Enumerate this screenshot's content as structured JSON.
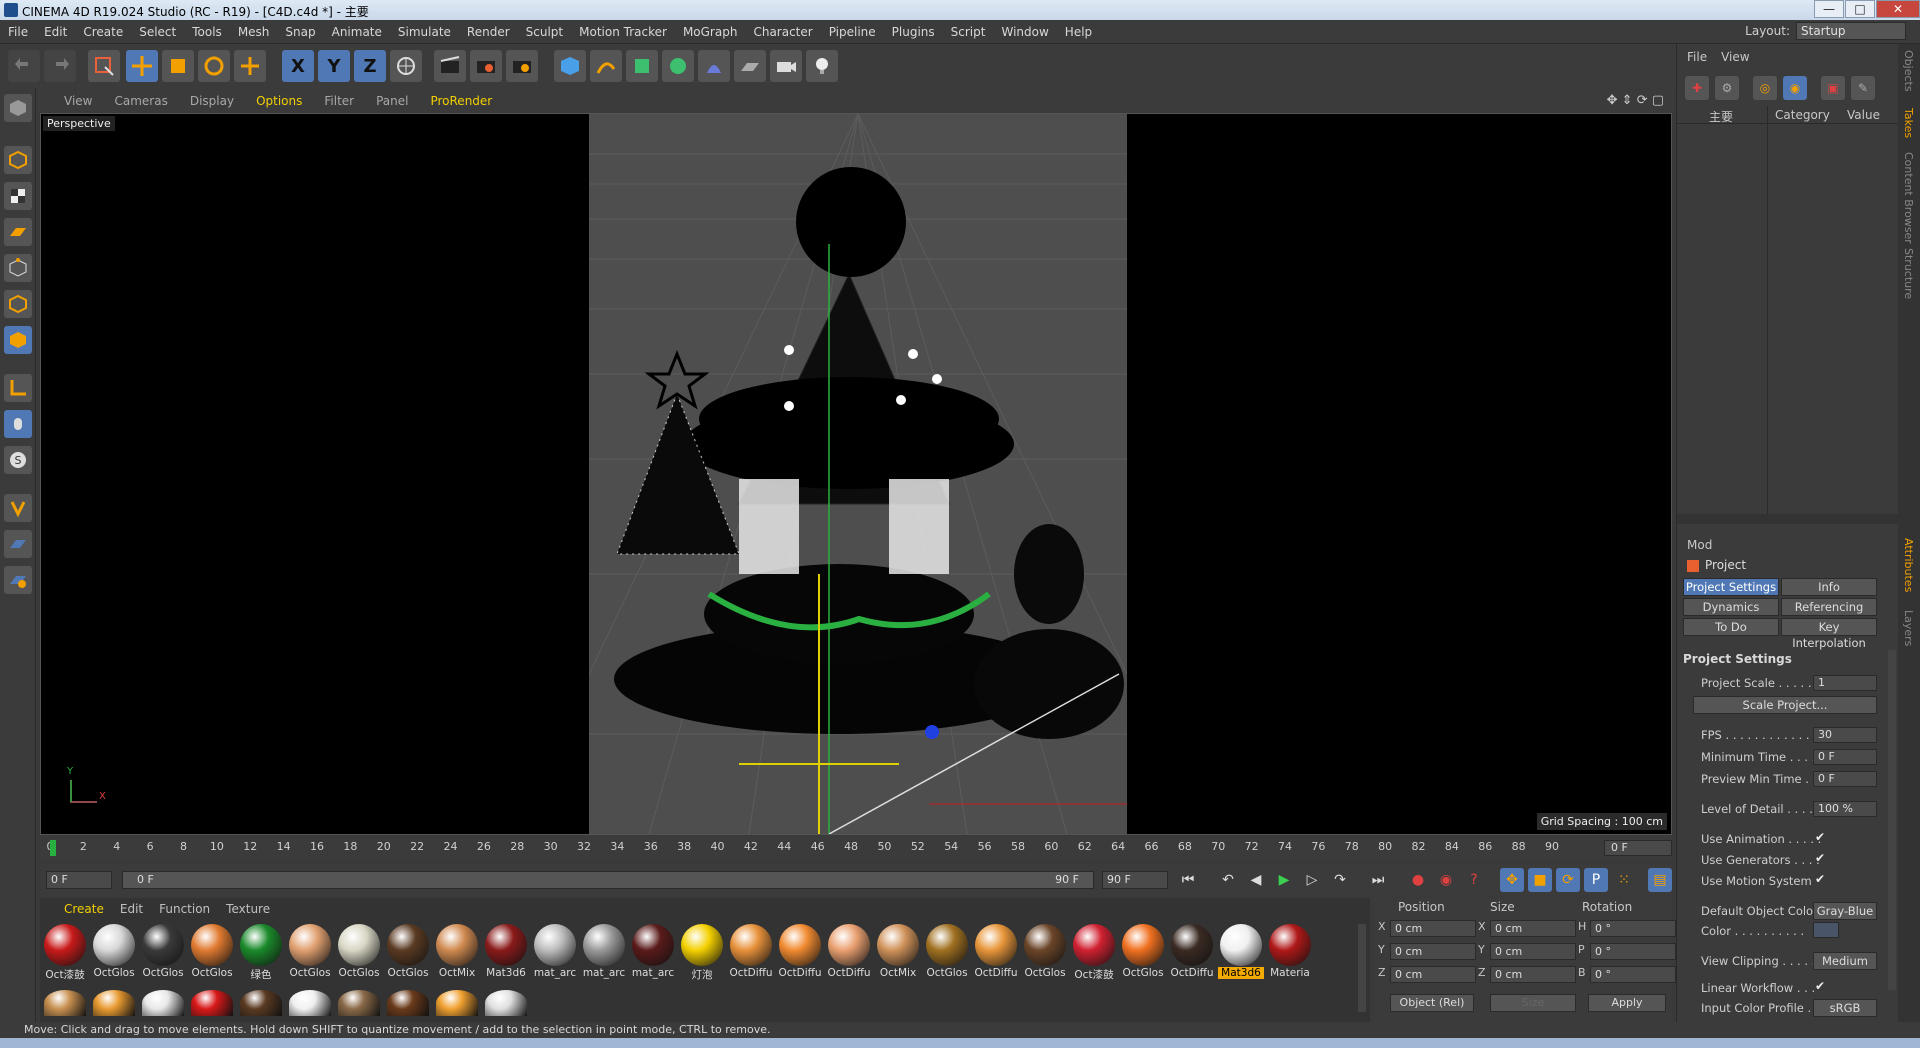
{
  "window": {
    "title": "CINEMA 4D R19.024 Studio (RC - R19) - [C4D.c4d *] - 主要",
    "controls": [
      "—",
      "□",
      "✕"
    ]
  },
  "menu": [
    "File",
    "Edit",
    "Create",
    "Select",
    "Tools",
    "Mesh",
    "Snap",
    "Animate",
    "Simulate",
    "Render",
    "Sculpt",
    "Motion Tracker",
    "MoGraph",
    "Character",
    "Pipeline",
    "Plugins",
    "Script",
    "Window",
    "Help"
  ],
  "layout": {
    "label": "Layout:",
    "value": "Startup"
  },
  "toolbar": {
    "axis_x": "X",
    "axis_y": "Y",
    "axis_z": "Z"
  },
  "viewport": {
    "menu": [
      "View",
      "Cameras",
      "Display",
      "Options",
      "Filter",
      "Panel",
      "ProRender"
    ],
    "active_menu": "Options",
    "camera_label": "Perspective",
    "grid_spacing": "Grid Spacing : 100 cm",
    "axis_y": "Y",
    "axis_x": "X"
  },
  "timeline": {
    "ticks": [
      "0",
      "2",
      "4",
      "6",
      "8",
      "10",
      "12",
      "14",
      "16",
      "18",
      "20",
      "22",
      "24",
      "26",
      "28",
      "30",
      "32",
      "34",
      "36",
      "38",
      "40",
      "42",
      "44",
      "46",
      "48",
      "50",
      "52",
      "54",
      "56",
      "58",
      "60",
      "62",
      "64",
      "66",
      "68",
      "70",
      "72",
      "74",
      "76",
      "78",
      "80",
      "82",
      "84",
      "86",
      "88",
      "90"
    ],
    "current_frame": "0 F",
    "start": "0 F",
    "slider_start": "0 F",
    "slider_end": "90 F",
    "end": "90 F"
  },
  "materials": {
    "tabs": [
      "Create",
      "Edit",
      "Function",
      "Texture"
    ],
    "active_tab": "Create",
    "items": [
      {
        "label": "Oct漆鼓",
        "color": "#c81a1a"
      },
      {
        "label": "OctGlos",
        "color": "#d8d8d8"
      },
      {
        "label": "OctGlos",
        "color": "#3a3a3a"
      },
      {
        "label": "OctGlos",
        "color": "#e07a30"
      },
      {
        "label": "绿色",
        "color": "#1a8a2a"
      },
      {
        "label": "OctGlos",
        "color": "#e0a070"
      },
      {
        "label": "OctGlos",
        "color": "#d8d6c4"
      },
      {
        "label": "OctGlos",
        "color": "#5a3a22"
      },
      {
        "label": "OctMix",
        "color": "#d08a50"
      },
      {
        "label": "Mat3d6",
        "color": "#8a1a1a"
      },
      {
        "label": "mat_arc",
        "color": "#bdbdbd"
      },
      {
        "label": "mat_arc",
        "color": "#9a9a9a"
      },
      {
        "label": "mat_arc",
        "color": "#5a1a1a"
      },
      {
        "label": "灯泡",
        "color": "#f4d000"
      },
      {
        "label": "OctDiffu",
        "color": "#e8913a"
      },
      {
        "label": "OctDiffu",
        "color": "#f08a30"
      },
      {
        "label": "OctDiffu",
        "color": "#eaa070"
      },
      {
        "label": "OctMix",
        "color": "#d0925a"
      },
      {
        "label": "OctGlos",
        "color": "#a07020"
      },
      {
        "label": "OctDiffu",
        "color": "#e8963a"
      },
      {
        "label": "OctGlos",
        "color": "#6a4428"
      },
      {
        "label": "Oct漆鼓",
        "color": "#d02030"
      },
      {
        "label": "OctGlos",
        "color": "#f07020"
      },
      {
        "label": "OctDiffu",
        "color": "#3a2a22"
      },
      {
        "label": "Mat3d6",
        "color": "#f0f0f0"
      },
      {
        "label": "Materia",
        "color": "#b01818"
      }
    ],
    "selected_index": 24,
    "second_row": [
      "#c89050",
      "#e89a30",
      "#e8e8e8",
      "#d81818",
      "#5a3a22",
      "#f0f0f0",
      "#8a6a48",
      "#6a3a1a",
      "#f0a030",
      "#e0e0e0"
    ]
  },
  "coords": {
    "headers": [
      "Position",
      "Size",
      "Rotation"
    ],
    "rows": [
      {
        "a": "X",
        "pos": "0 cm",
        "b": "X",
        "size": "0 cm",
        "c": "H",
        "rot": "0 °"
      },
      {
        "a": "Y",
        "pos": "0 cm",
        "b": "Y",
        "size": "0 cm",
        "c": "P",
        "rot": "0 °"
      },
      {
        "a": "Z",
        "pos": "0 cm",
        "b": "Z",
        "size": "0 cm",
        "c": "B",
        "rot": "0 °"
      }
    ],
    "mode": "Object (Rel)",
    "size_mode": "Size",
    "apply": "Apply"
  },
  "status": "Move: Click and drag to move elements. Hold down SHIFT to quantize movement / add to the selection in point mode, CTRL to remove.",
  "object_manager": {
    "menu": [
      "File",
      "View"
    ],
    "columns": [
      "主要",
      "Category",
      "Value"
    ]
  },
  "attributes": {
    "menu": "Mod",
    "title": "Project",
    "tabs": [
      "Project Settings",
      "Info",
      "Dynamics",
      "Referencing",
      "To Do",
      "Key Interpolation"
    ],
    "active_tab": "Project Settings",
    "section": "Project Settings",
    "fields": [
      {
        "label": "Project Scale . . . . . .",
        "value": "1"
      },
      {
        "label": "FPS . . . . . . . . . . . . . .",
        "value": "30"
      },
      {
        "label": "Minimum Time . . . .",
        "value": "0 F"
      },
      {
        "label": "Preview Min Time . .",
        "value": "0 F"
      },
      {
        "label": "Level of Detail . . . . .",
        "value": "100 %"
      }
    ],
    "scale_button": "Scale Project...",
    "checks": [
      "Use Animation . . . . .",
      "Use Generators . . . .",
      "Use Motion System"
    ],
    "check_mark": "✔",
    "default_color_label": "Default Object Color",
    "default_color_value": "Gray-Blue",
    "color_label": "Color . . . . . . . . . .",
    "view_clipping_label": "View Clipping . . . . .",
    "view_clipping_value": "Medium",
    "linear_workflow_label": "Linear Workflow . . .",
    "input_profile_label": "Input Color Profile . .",
    "input_profile_value": "sRGB"
  },
  "side_tabs": [
    "Objects",
    "Takes",
    "Content Browser",
    "Structure",
    "Attributes",
    "Layers"
  ],
  "colors": {
    "accent": "#f2d000",
    "active_button": "#5078b4",
    "viewport_bg": "#000000",
    "scene_bg": "#4e4e4e"
  }
}
